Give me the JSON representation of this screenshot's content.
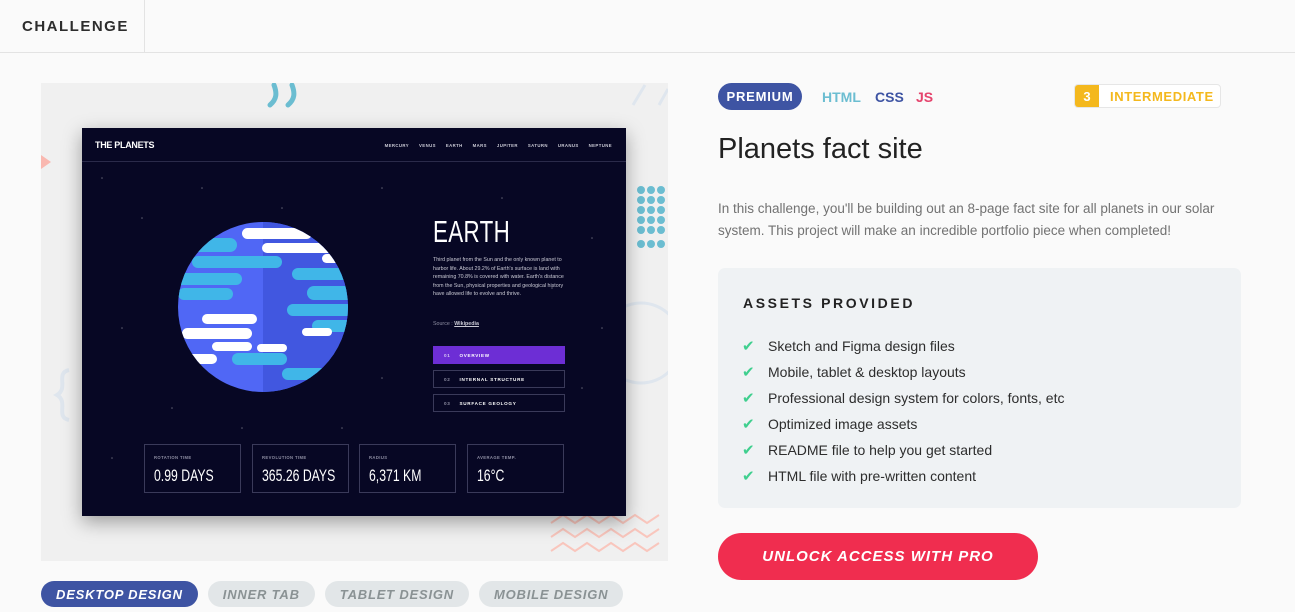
{
  "topbar": {
    "tab_label": "CHALLENGE"
  },
  "preview": {
    "site": {
      "logo": "THE PLANETS",
      "nav": [
        "MERCURY",
        "VENUS",
        "EARTH",
        "MARS",
        "JUPITER",
        "SATURN",
        "URANUS",
        "NEPTUNE"
      ],
      "planet_name": "EARTH",
      "description": "Third planet from the Sun and the only known planet to harbor life. About 29.2% of Earth's surface is land with remaining 70.8% is covered with water. Earth's distance from the Sun, physical properties and geological history have allowed life to evolve and thrive.",
      "source_label": "Source :",
      "source_link": "Wikipedia",
      "buttons": [
        {
          "num": "01",
          "label": "OVERVIEW"
        },
        {
          "num": "02",
          "label": "INTERNAL STRUCTURE"
        },
        {
          "num": "03",
          "label": "SURFACE GEOLOGY"
        }
      ],
      "stats": [
        {
          "label": "ROTATION TIME",
          "value": "0.99 DAYS"
        },
        {
          "label": "REVOLUTION TIME",
          "value": "365.26 DAYS"
        },
        {
          "label": "RADIUS",
          "value": "6,371 KM"
        },
        {
          "label": "AVERAGE TEMP.",
          "value": "16°C"
        }
      ],
      "colors": {
        "background": "#070724",
        "accent": "#6d2ed5"
      }
    },
    "tabs": [
      "DESKTOP DESIGN",
      "INNER TAB",
      "TABLET DESIGN",
      "MOBILE DESIGN"
    ],
    "active_tab": "DESKTOP DESIGN"
  },
  "challenge": {
    "badge": "PREMIUM",
    "languages": [
      {
        "name": "HTML",
        "color": "#6bbdd1"
      },
      {
        "name": "CSS",
        "color": "#3e54a3"
      },
      {
        "name": "JS",
        "color": "#e5446d"
      }
    ],
    "level_number": "3",
    "level_label": "INTERMEDIATE",
    "title": "Planets fact site",
    "intro": "In this challenge, you'll be building out an 8-page fact site for all planets in our solar system. This project will make an incredible portfolio piece when completed!",
    "assets_heading": "ASSETS PROVIDED",
    "assets": [
      "Sketch and Figma design files",
      "Mobile, tablet & desktop layouts",
      "Professional design system for colors, fonts, etc",
      "Optimized image assets",
      "README file to help you get started",
      "HTML file with pre-written content"
    ],
    "cta": "UNLOCK ACCESS WITH PRO",
    "colors": {
      "premium": "#3e54a3",
      "level": "#f4b81d",
      "check": "#3fcf8e",
      "cta": "#f02d4f"
    }
  }
}
